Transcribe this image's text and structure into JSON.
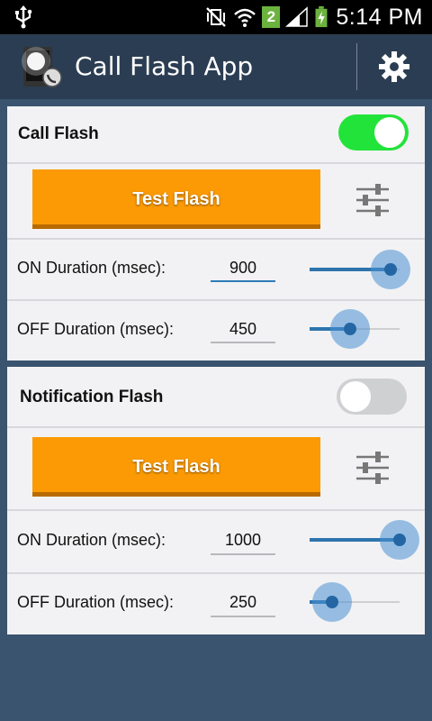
{
  "status_bar": {
    "time": "5:14 PM",
    "notification_count": "2",
    "icons": [
      "usb-icon",
      "vibrate-mute-icon",
      "wifi-icon",
      "signal-icon",
      "battery-charging-icon"
    ]
  },
  "action_bar": {
    "title": "Call Flash App",
    "settings_icon": "gear-icon"
  },
  "call_flash": {
    "title": "Call Flash",
    "enabled": true,
    "test_button": "Test Flash",
    "settings_icon": "equalizer-icon",
    "on_label": "ON Duration (msec):",
    "on_value": "900",
    "on_slider": 0.9,
    "off_label": "OFF Duration (msec):",
    "off_value": "450",
    "off_slider": 0.45
  },
  "notification_flash": {
    "title": "Notification Flash",
    "enabled": false,
    "test_button": "Test Flash",
    "settings_icon": "equalizer-icon",
    "on_label": "ON Duration (msec):",
    "on_value": "1000",
    "on_slider": 1.0,
    "off_label": "OFF Duration (msec):",
    "off_value": "250",
    "off_slider": 0.25
  },
  "colors": {
    "accent": "#fb9a04",
    "toggle_on": "#22e33a",
    "slider": "#2d74ad",
    "background": "#3a536e",
    "action_bar": "#2b3d52"
  }
}
